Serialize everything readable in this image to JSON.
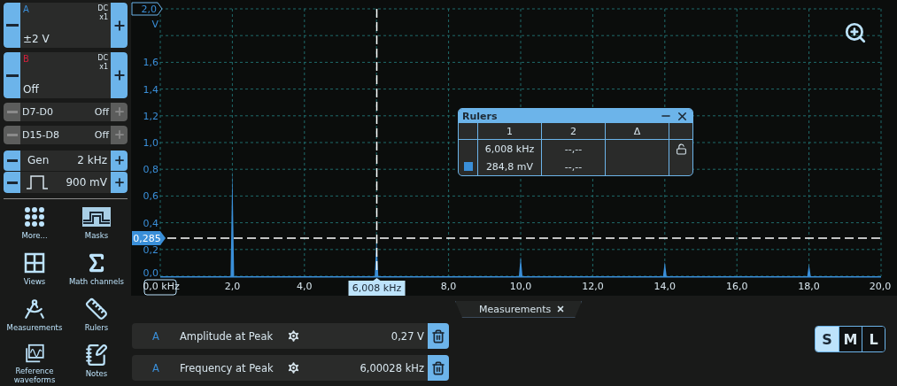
{
  "channels": [
    {
      "kind": "analog",
      "name": "A",
      "color": "#3a8fd9",
      "coupling": "DC",
      "probe": "x1",
      "range": "±2 V",
      "disabled": false
    },
    {
      "kind": "analog",
      "name": "B",
      "color": "#d41f3c",
      "coupling": "DC",
      "probe": "x1",
      "range": "Off",
      "disabled": false
    },
    {
      "kind": "digital",
      "name": "D7-D0",
      "value": "Off",
      "disabled": true
    },
    {
      "kind": "digital",
      "name": "D15-D8",
      "value": "Off",
      "disabled": true
    }
  ],
  "generator": {
    "label": "Gen",
    "frequency": "2 kHz",
    "amplitude": "900 mV"
  },
  "tools": [
    {
      "label": "More..."
    },
    {
      "label": "Masks"
    },
    {
      "label": "Views"
    },
    {
      "label": "Math channels"
    },
    {
      "label": "Measurements"
    },
    {
      "label": "Rulers"
    },
    {
      "label": "Reference waveforms"
    },
    {
      "label": "Notes"
    }
  ],
  "chart": {
    "chart_data": {
      "type": "area",
      "ylabel": "V",
      "xlim": [
        0,
        20
      ],
      "ylim": [
        0,
        2
      ],
      "xticks": [
        {
          "value": 0,
          "label": "0,0 kHz"
        },
        {
          "value": 2,
          "label": "2,0"
        },
        {
          "value": 4,
          "label": "4,0"
        },
        {
          "value": 8,
          "label": "8,0"
        },
        {
          "value": 10,
          "label": "10,0"
        },
        {
          "value": 12,
          "label": "12,0"
        },
        {
          "value": 14,
          "label": "14,0"
        },
        {
          "value": 16,
          "label": "16,0"
        },
        {
          "value": 18,
          "label": "18,0"
        },
        {
          "value": 20,
          "label": "20,0"
        }
      ],
      "yticks": [
        {
          "value": 2,
          "label": "2,0"
        },
        {
          "value": 1.6,
          "label": "1,6"
        },
        {
          "value": 1.4,
          "label": "1,4"
        },
        {
          "value": 1.2,
          "label": "1,2"
        },
        {
          "value": 1,
          "label": "1,0"
        },
        {
          "value": 0.8,
          "label": "0,8"
        },
        {
          "value": 0.6,
          "label": "0,6"
        },
        {
          "value": 0.4,
          "label": "0,4"
        },
        {
          "value": 0.2,
          "label": "0,2"
        },
        {
          "value": 0,
          "label": "0,0"
        }
      ],
      "x": [
        0,
        1.95,
        2,
        2.05,
        5.95,
        6,
        6.05,
        9.95,
        10,
        10.05,
        13.95,
        14,
        14.05,
        17.95,
        18,
        18.05,
        20
      ],
      "grid": true,
      "series": [
        {
          "color": "#3a8fd9",
          "values": [
            0,
            0,
            0.8,
            0,
            0,
            0.28,
            0,
            0,
            0.15,
            0,
            0,
            0.11,
            0,
            0,
            0.09,
            0,
            0
          ]
        }
      ],
      "ref_lines": [
        {
          "axis": "x",
          "value": 6.008,
          "label": "6,008 kHz"
        },
        {
          "axis": "y",
          "value": 0.285,
          "label": "0,285"
        }
      ]
    }
  },
  "rulers_window": {
    "title": "Rulers",
    "columns": [
      "1",
      "2",
      "Δ"
    ],
    "locked": false,
    "rows": [
      {
        "values": [
          "6,008 kHz",
          "--,--"
        ]
      },
      {
        "color": "#3a8fd9",
        "values": [
          "284,8 mV",
          "--,--"
        ]
      }
    ]
  },
  "measurements_tab": {
    "label": "Measurements"
  },
  "measurements": [
    {
      "channel": "A",
      "name": "Amplitude at Peak",
      "value": "0,27 V"
    },
    {
      "channel": "A",
      "name": "Frequency at Peak",
      "value": "6,00028 kHz"
    }
  ],
  "size_buttons": [
    {
      "label": "S",
      "selected": true
    },
    {
      "label": "M",
      "selected": false
    },
    {
      "label": "L",
      "selected": false
    }
  ]
}
